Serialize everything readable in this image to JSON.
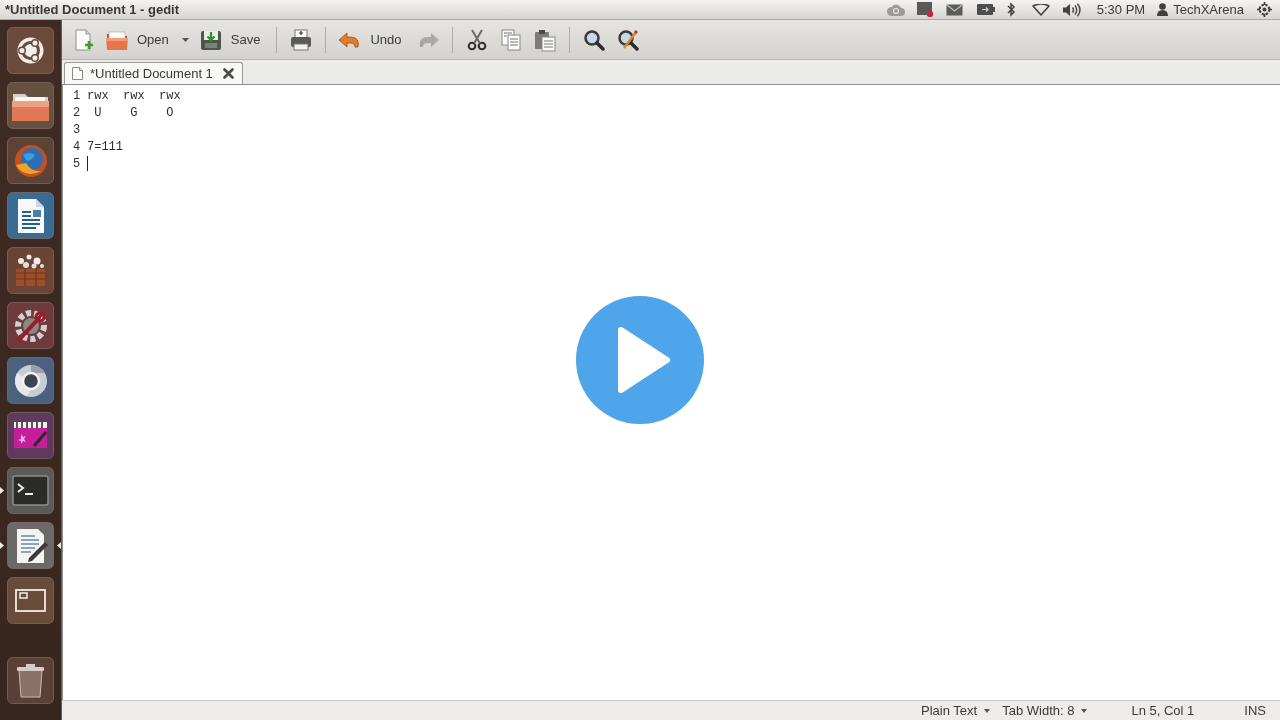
{
  "top_panel": {
    "window_title": "*Untitled Document 1 - gedit",
    "clock": "5:30 PM",
    "user": "TechXArena"
  },
  "launcher": {
    "items": [
      {
        "running": false,
        "focused": false
      },
      {
        "running": false,
        "focused": false
      },
      {
        "running": false,
        "focused": false
      },
      {
        "running": false,
        "focused": false
      },
      {
        "running": false,
        "focused": false
      },
      {
        "running": false,
        "focused": false
      },
      {
        "running": false,
        "focused": false
      },
      {
        "running": false,
        "focused": false
      },
      {
        "running": true,
        "focused": false
      },
      {
        "running": true,
        "focused": true
      },
      {
        "running": false,
        "focused": false
      },
      {
        "running": false,
        "focused": false
      }
    ]
  },
  "toolbar": {
    "groups": [
      [
        {
          "kind": "button",
          "disabled": false
        },
        {
          "kind": "menu_button",
          "label": "Open",
          "disabled": false
        },
        {
          "kind": "button",
          "label": "Save",
          "disabled": false
        }
      ],
      [
        {
          "kind": "button",
          "disabled": false
        }
      ],
      [
        {
          "kind": "button",
          "label": "Undo",
          "disabled": false
        },
        {
          "kind": "button",
          "disabled": true
        }
      ],
      [
        {
          "kind": "button",
          "disabled": false
        },
        {
          "kind": "button",
          "disabled": false
        },
        {
          "kind": "button",
          "disabled": false
        }
      ],
      [
        {
          "kind": "button",
          "disabled": false
        },
        {
          "kind": "button",
          "disabled": false
        }
      ]
    ]
  },
  "tabs": [
    {
      "label": "*Untitled Document 1",
      "selected": true
    }
  ],
  "editor": {
    "lines": [
      {
        "number": "1",
        "text": "rwx  rwx  rwx",
        "has_cursor": false
      },
      {
        "number": "2",
        "text": " U    G    O",
        "has_cursor": false
      },
      {
        "number": "3",
        "has_cursor": false
      },
      {
        "number": "4",
        "text": "7=111",
        "has_cursor": false
      },
      {
        "number": "5",
        "has_cursor": true
      }
    ]
  },
  "status_bar": {
    "language": "Plain Text",
    "tab_width": "Tab Width: 8",
    "position": "Ln 5, Col 1",
    "mode": "INS"
  }
}
